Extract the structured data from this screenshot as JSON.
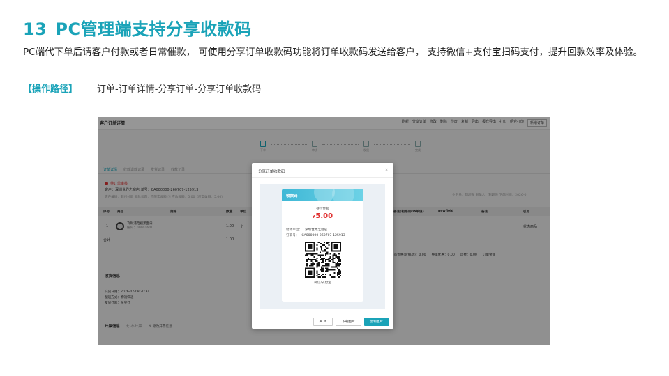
{
  "slide": {
    "number": "13",
    "title": "PC管理端支持分享收款码",
    "description": "PC端代下单后请客户付款或者日常催款，  可使用分享订单收款码功能将订单收款码发送给客户，  支持微信+支付宝扫码支付，提升回款效率及体验。",
    "path_tag": "【操作路径】",
    "path_text": "订单-订单详情-分享订单-分享订单收款码"
  },
  "app": {
    "page_title": "客户订单详情",
    "toolbar": [
      "刷新",
      "分享订单",
      "修改",
      "删除",
      "作废",
      "复制",
      "导出",
      "报仓导出",
      "打印",
      "组合打印"
    ],
    "new_order": "新增订单",
    "steps": [
      "下单",
      "审核",
      "发货",
      "完成"
    ],
    "tabs": [
      "订单详情",
      "收款退款记录",
      "发货记录",
      "收款记录"
    ],
    "order_status": "待订单审核",
    "customer_line": "客户：深圳世界之窗店    单号：CA000000-260707-125913",
    "meta_line": "客户编码：非付付款    收款状态：不限实收额 ⓘ    应收收额：5.00（应实收额：5.00）",
    "right_meta": "业务员：刘超强    制单人：刘超强    下单时间：2026-0",
    "table_headers": [
      "序号",
      "商品",
      "规格",
      "数量",
      "单位",
      "备注(相等同OA单值)",
      "newfield",
      "备注",
      "引用"
    ],
    "row": {
      "index": "1",
      "product": "飞利浦电视黑面白...",
      "code": "编码：00001601",
      "qty": "1.00",
      "unit": "个",
      "ref": "状态商品"
    },
    "subtotal_label": "合计",
    "subtotal_qty": "1.00",
    "totals": [
      "商品优惠(含赠品)：0.00",
      "整单优惠：0.00",
      "运费：0.00",
      "订单金额"
    ],
    "shipping_title": "收货信息",
    "shipping_lines": [
      "交货日期：2026-07-08 20:34",
      "配送方式：物流快递",
      "发货仓库：东莞仓"
    ],
    "invoice_title": "开票信息",
    "invoice_note": "无  不开票",
    "invoice_edit": "✎ 修改开票信息"
  },
  "modal": {
    "title": "分享订单收款码",
    "close": "×",
    "card_title": "收款码",
    "amount_label": "待付金额",
    "currency": "¥",
    "amount": "5.00",
    "payer_key": "付款单位：",
    "payer_value": "深圳世界之窗店",
    "order_key": "订单号：",
    "order_value": "CA000000-260707-125913",
    "pay_methods": "微信/支付宝",
    "btn_close": "关 闭",
    "btn_download": "下载图片",
    "btn_copy": "复制图片"
  },
  "colors": {
    "accent": "#1aa3b8",
    "amount": "#e03030"
  }
}
